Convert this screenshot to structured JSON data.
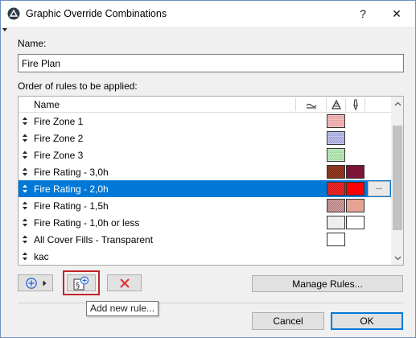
{
  "window": {
    "title": "Graphic Override Combinations",
    "help_glyph": "?",
    "close_glyph": "✕"
  },
  "name_label": "Name:",
  "name_value": "Fire Plan",
  "order_label": "Order of rules to be applied:",
  "list": {
    "header": {
      "name": "Name",
      "icon_cols": [
        "surface-fill-icon",
        "cut-fill-icon",
        "pen-icon"
      ]
    },
    "rows": [
      {
        "name": "Fire Zone 1",
        "swatches": [
          {
            "fill": "#f4c6c6",
            "pattern": "dots",
            "ink": "#c04040"
          }
        ],
        "selected": false
      },
      {
        "name": "Fire Zone 2",
        "swatches": [
          {
            "fill": "#c8caf0",
            "pattern": "dots",
            "ink": "#3a3aa0"
          }
        ],
        "selected": false
      },
      {
        "name": "Fire Zone 3",
        "swatches": [
          {
            "fill": "#c9efc9",
            "pattern": "dots",
            "ink": "#3a9a3a"
          }
        ],
        "selected": false
      },
      {
        "name": "Fire Rating - 3,0h",
        "swatches": [
          {
            "fill": "#b0482a",
            "pattern": "hatch",
            "ink": "#5a1e10"
          },
          {
            "fill": "#7d1437",
            "pattern": "solid",
            "ink": "#7d1437"
          }
        ],
        "selected": false
      },
      {
        "name": "Fire Rating - 2,0h",
        "swatches": [
          {
            "fill": "#ff4040",
            "pattern": "hatch",
            "ink": "#c00000"
          },
          {
            "fill": "#ff0000",
            "pattern": "solid",
            "ink": "#ff0000"
          }
        ],
        "selected": true,
        "more": "..."
      },
      {
        "name": "Fire Rating - 1,5h",
        "swatches": [
          {
            "fill": "#e4b3b3",
            "pattern": "hatch",
            "ink": "#9a6a6a"
          },
          {
            "fill": "#e6a393",
            "pattern": "solid",
            "ink": "#e6a393"
          }
        ],
        "selected": false
      },
      {
        "name": "Fire Rating - 1,0h or less",
        "swatches": [
          {
            "fill": "#eeeeee",
            "pattern": "solid",
            "ink": "#eeeeee"
          },
          {
            "fill": "#ffffff",
            "pattern": "solid",
            "ink": "#ffffff"
          }
        ],
        "selected": false
      },
      {
        "name": "All Cover Fills - Transparent",
        "swatches": [
          {
            "fill": "#ffffff",
            "pattern": "solid",
            "ink": "#ffffff"
          }
        ],
        "selected": false
      },
      {
        "name": "kac",
        "swatches": [],
        "selected": false
      }
    ]
  },
  "buttons": {
    "manage_rules": "Manage Rules...",
    "cancel": "Cancel",
    "ok": "OK"
  },
  "tooltip": "Add new rule...",
  "colors": {
    "selection": "#0078d7",
    "highlight_border": "#c0252a",
    "delete_x": "#e03030",
    "add_icon": "#2a6ad0"
  }
}
